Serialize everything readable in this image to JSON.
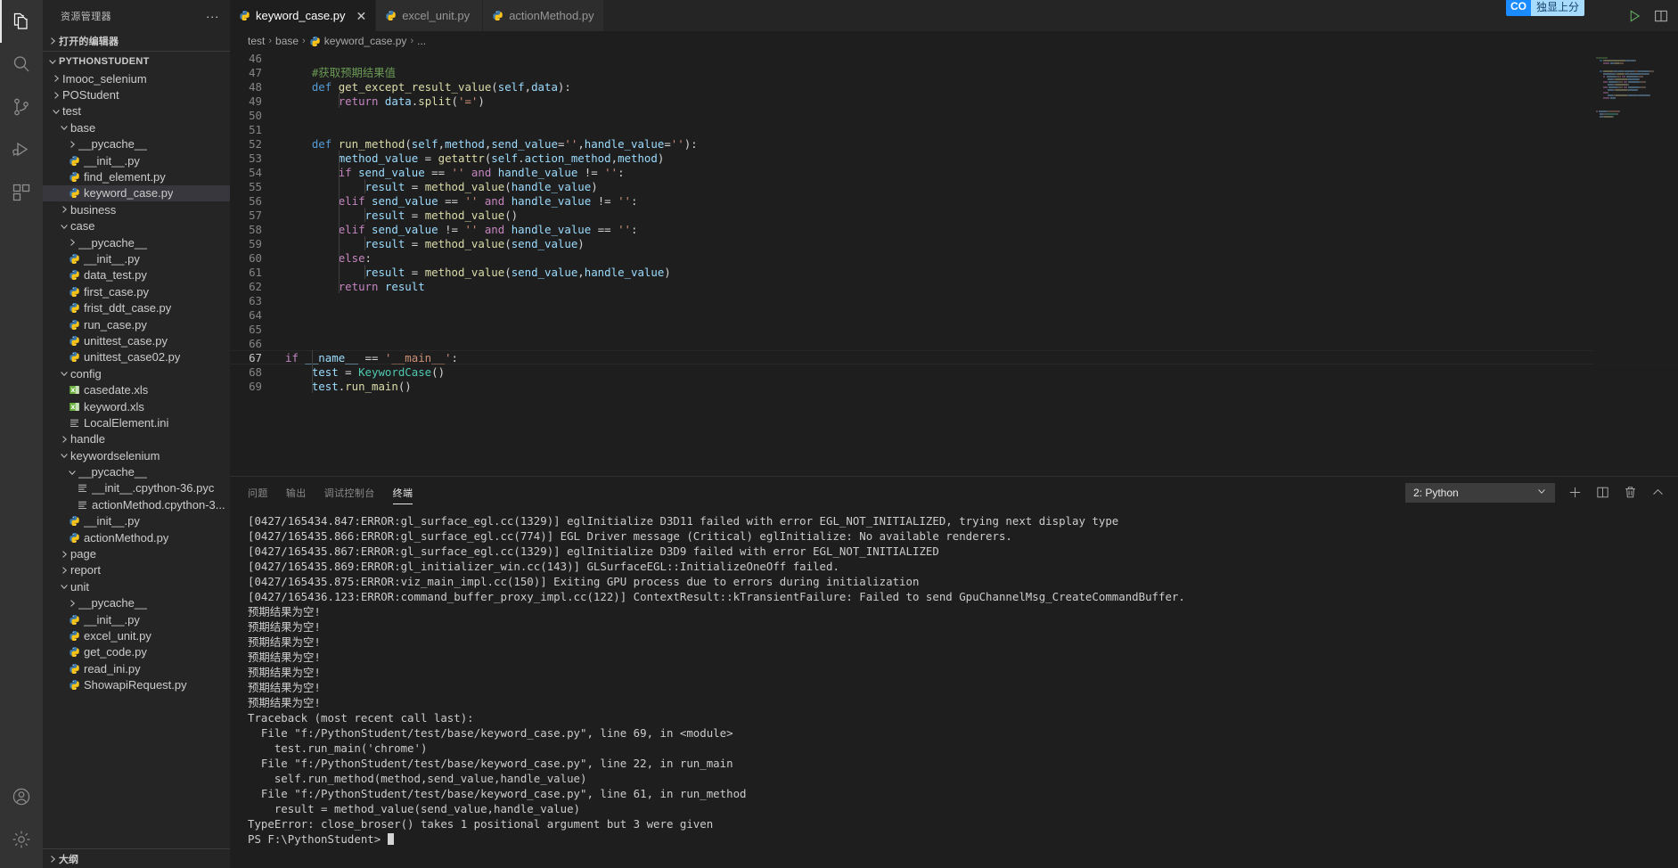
{
  "activitybar": {
    "items": [
      {
        "name": "explorer-icon",
        "label": "资源管理器",
        "active": true
      },
      {
        "name": "search-icon",
        "label": "搜索",
        "active": false
      },
      {
        "name": "source-control-icon",
        "label": "源代码管理",
        "active": false
      },
      {
        "name": "run-debug-icon",
        "label": "运行和调试",
        "active": false
      },
      {
        "name": "extensions-icon",
        "label": "扩展",
        "active": false
      }
    ],
    "bottom": [
      {
        "name": "account-icon",
        "label": "帐户"
      },
      {
        "name": "manage-gear-icon",
        "label": "管理"
      }
    ]
  },
  "sidebar": {
    "title": "资源管理器",
    "more_label": "···",
    "open_editors_label": "打开的编辑器",
    "root_label": "PYTHONSTUDENT",
    "outline_label": "大纲",
    "tree": [
      {
        "label": "Imooc_selenium",
        "depth": 1,
        "type": "folder",
        "state": "collapsed"
      },
      {
        "label": "POStudent",
        "depth": 1,
        "type": "folder",
        "state": "collapsed"
      },
      {
        "label": "test",
        "depth": 1,
        "type": "folder",
        "state": "expanded"
      },
      {
        "label": "base",
        "depth": 2,
        "type": "folder",
        "state": "expanded"
      },
      {
        "label": "__pycache__",
        "depth": 3,
        "type": "folder",
        "state": "collapsed"
      },
      {
        "label": "__init__.py",
        "depth": 3,
        "type": "python"
      },
      {
        "label": "find_element.py",
        "depth": 3,
        "type": "python"
      },
      {
        "label": "keyword_case.py",
        "depth": 3,
        "type": "python",
        "selected": true
      },
      {
        "label": "business",
        "depth": 2,
        "type": "folder",
        "state": "collapsed"
      },
      {
        "label": "case",
        "depth": 2,
        "type": "folder",
        "state": "expanded"
      },
      {
        "label": "__pycache__",
        "depth": 3,
        "type": "folder",
        "state": "collapsed"
      },
      {
        "label": "__init__.py",
        "depth": 3,
        "type": "python"
      },
      {
        "label": "data_test.py",
        "depth": 3,
        "type": "python"
      },
      {
        "label": "first_case.py",
        "depth": 3,
        "type": "python"
      },
      {
        "label": "frist_ddt_case.py",
        "depth": 3,
        "type": "python"
      },
      {
        "label": "run_case.py",
        "depth": 3,
        "type": "python"
      },
      {
        "label": "unittest_case.py",
        "depth": 3,
        "type": "python"
      },
      {
        "label": "unittest_case02.py",
        "depth": 3,
        "type": "python"
      },
      {
        "label": "config",
        "depth": 2,
        "type": "folder",
        "state": "expanded"
      },
      {
        "label": "casedate.xls",
        "depth": 3,
        "type": "excel"
      },
      {
        "label": "keyword.xls",
        "depth": 3,
        "type": "excel"
      },
      {
        "label": "LocalElement.ini",
        "depth": 3,
        "type": "ini"
      },
      {
        "label": "handle",
        "depth": 2,
        "type": "folder",
        "state": "collapsed"
      },
      {
        "label": "keywordselenium",
        "depth": 2,
        "type": "folder",
        "state": "expanded"
      },
      {
        "label": "__pycache__",
        "depth": 3,
        "type": "folder",
        "state": "expanded"
      },
      {
        "label": "__init__.cpython-36.pyc",
        "depth": 4,
        "type": "ini"
      },
      {
        "label": "actionMethod.cpython-3...",
        "depth": 4,
        "type": "ini"
      },
      {
        "label": "__init__.py",
        "depth": 3,
        "type": "python"
      },
      {
        "label": "actionMethod.py",
        "depth": 3,
        "type": "python"
      },
      {
        "label": "page",
        "depth": 2,
        "type": "folder",
        "state": "collapsed"
      },
      {
        "label": "report",
        "depth": 2,
        "type": "folder",
        "state": "collapsed"
      },
      {
        "label": "unit",
        "depth": 2,
        "type": "folder",
        "state": "expanded"
      },
      {
        "label": "__pycache__",
        "depth": 3,
        "type": "folder",
        "state": "collapsed"
      },
      {
        "label": "__init__.py",
        "depth": 3,
        "type": "python"
      },
      {
        "label": "excel_unit.py",
        "depth": 3,
        "type": "python"
      },
      {
        "label": "get_code.py",
        "depth": 3,
        "type": "python"
      },
      {
        "label": "read_ini.py",
        "depth": 3,
        "type": "python"
      },
      {
        "label": "ShowapiRequest.py",
        "depth": 3,
        "type": "python"
      }
    ]
  },
  "editor": {
    "tabs": [
      {
        "label": "keyword_case.py",
        "active": true,
        "close_glyph": "✕"
      },
      {
        "label": "excel_unit.py",
        "active": false
      },
      {
        "label": "actionMethod.py",
        "active": false
      }
    ],
    "breadcrumb": [
      "test",
      "base",
      "keyword_case.py",
      "..."
    ],
    "breadcrumb_sep": "›",
    "first_line_number": 46,
    "lines": [
      {
        "n": 46,
        "tokens": []
      },
      {
        "n": 47,
        "tokens": [
          {
            "c": "cmt",
            "t": "    #获取预期结果值"
          }
        ]
      },
      {
        "n": 48,
        "tokens": [
          {
            "c": "plain",
            "t": "    "
          },
          {
            "c": "def",
            "t": "def"
          },
          {
            "c": "plain",
            "t": " "
          },
          {
            "c": "fn",
            "t": "get_except_result_value"
          },
          {
            "c": "plain",
            "t": "("
          },
          {
            "c": "var",
            "t": "self"
          },
          {
            "c": "plain",
            "t": ","
          },
          {
            "c": "var",
            "t": "data"
          },
          {
            "c": "plain",
            "t": "):"
          }
        ]
      },
      {
        "n": 49,
        "tokens": [
          {
            "c": "plain",
            "t": "        "
          },
          {
            "c": "kw",
            "t": "return"
          },
          {
            "c": "plain",
            "t": " "
          },
          {
            "c": "var",
            "t": "data"
          },
          {
            "c": "plain",
            "t": "."
          },
          {
            "c": "fn",
            "t": "split"
          },
          {
            "c": "plain",
            "t": "("
          },
          {
            "c": "str",
            "t": "'='"
          },
          {
            "c": "plain",
            "t": ")"
          }
        ]
      },
      {
        "n": 50,
        "tokens": []
      },
      {
        "n": 51,
        "tokens": []
      },
      {
        "n": 52,
        "tokens": [
          {
            "c": "plain",
            "t": "    "
          },
          {
            "c": "def",
            "t": "def"
          },
          {
            "c": "plain",
            "t": " "
          },
          {
            "c": "fn",
            "t": "run_method"
          },
          {
            "c": "plain",
            "t": "("
          },
          {
            "c": "var",
            "t": "self"
          },
          {
            "c": "plain",
            "t": ","
          },
          {
            "c": "var",
            "t": "method"
          },
          {
            "c": "plain",
            "t": ","
          },
          {
            "c": "var",
            "t": "send_value"
          },
          {
            "c": "plain",
            "t": "="
          },
          {
            "c": "str",
            "t": "''"
          },
          {
            "c": "plain",
            "t": ","
          },
          {
            "c": "var",
            "t": "handle_value"
          },
          {
            "c": "plain",
            "t": "="
          },
          {
            "c": "str",
            "t": "''"
          },
          {
            "c": "plain",
            "t": "):"
          }
        ]
      },
      {
        "n": 53,
        "tokens": [
          {
            "c": "plain",
            "t": "        "
          },
          {
            "c": "var",
            "t": "method_value"
          },
          {
            "c": "plain",
            "t": " = "
          },
          {
            "c": "fn",
            "t": "getattr"
          },
          {
            "c": "plain",
            "t": "("
          },
          {
            "c": "var",
            "t": "self"
          },
          {
            "c": "plain",
            "t": "."
          },
          {
            "c": "var",
            "t": "action_method"
          },
          {
            "c": "plain",
            "t": ","
          },
          {
            "c": "var",
            "t": "method"
          },
          {
            "c": "plain",
            "t": ")"
          }
        ]
      },
      {
        "n": 54,
        "tokens": [
          {
            "c": "plain",
            "t": "        "
          },
          {
            "c": "kw",
            "t": "if"
          },
          {
            "c": "plain",
            "t": " "
          },
          {
            "c": "var",
            "t": "send_value"
          },
          {
            "c": "plain",
            "t": " == "
          },
          {
            "c": "str",
            "t": "''"
          },
          {
            "c": "plain",
            "t": " "
          },
          {
            "c": "kw",
            "t": "and"
          },
          {
            "c": "plain",
            "t": " "
          },
          {
            "c": "var",
            "t": "handle_value"
          },
          {
            "c": "plain",
            "t": " != "
          },
          {
            "c": "str",
            "t": "''"
          },
          {
            "c": "plain",
            "t": ":"
          }
        ]
      },
      {
        "n": 55,
        "tokens": [
          {
            "c": "plain",
            "t": "            "
          },
          {
            "c": "var",
            "t": "result"
          },
          {
            "c": "plain",
            "t": " = "
          },
          {
            "c": "fn",
            "t": "method_value"
          },
          {
            "c": "plain",
            "t": "("
          },
          {
            "c": "var",
            "t": "handle_value"
          },
          {
            "c": "plain",
            "t": ")"
          }
        ]
      },
      {
        "n": 56,
        "tokens": [
          {
            "c": "plain",
            "t": "        "
          },
          {
            "c": "kw",
            "t": "elif"
          },
          {
            "c": "plain",
            "t": " "
          },
          {
            "c": "var",
            "t": "send_value"
          },
          {
            "c": "plain",
            "t": " == "
          },
          {
            "c": "str",
            "t": "''"
          },
          {
            "c": "plain",
            "t": " "
          },
          {
            "c": "kw",
            "t": "and"
          },
          {
            "c": "plain",
            "t": " "
          },
          {
            "c": "var",
            "t": "handle_value"
          },
          {
            "c": "plain",
            "t": " != "
          },
          {
            "c": "str",
            "t": "''"
          },
          {
            "c": "plain",
            "t": ":"
          }
        ]
      },
      {
        "n": 57,
        "tokens": [
          {
            "c": "plain",
            "t": "            "
          },
          {
            "c": "var",
            "t": "result"
          },
          {
            "c": "plain",
            "t": " = "
          },
          {
            "c": "fn",
            "t": "method_value"
          },
          {
            "c": "plain",
            "t": "()"
          }
        ]
      },
      {
        "n": 58,
        "tokens": [
          {
            "c": "plain",
            "t": "        "
          },
          {
            "c": "kw",
            "t": "elif"
          },
          {
            "c": "plain",
            "t": " "
          },
          {
            "c": "var",
            "t": "send_value"
          },
          {
            "c": "plain",
            "t": " != "
          },
          {
            "c": "str",
            "t": "''"
          },
          {
            "c": "plain",
            "t": " "
          },
          {
            "c": "kw",
            "t": "and"
          },
          {
            "c": "plain",
            "t": " "
          },
          {
            "c": "var",
            "t": "handle_value"
          },
          {
            "c": "plain",
            "t": " == "
          },
          {
            "c": "str",
            "t": "''"
          },
          {
            "c": "plain",
            "t": ":"
          }
        ]
      },
      {
        "n": 59,
        "tokens": [
          {
            "c": "plain",
            "t": "            "
          },
          {
            "c": "var",
            "t": "result"
          },
          {
            "c": "plain",
            "t": " = "
          },
          {
            "c": "fn",
            "t": "method_value"
          },
          {
            "c": "plain",
            "t": "("
          },
          {
            "c": "var",
            "t": "send_value"
          },
          {
            "c": "plain",
            "t": ")"
          }
        ]
      },
      {
        "n": 60,
        "tokens": [
          {
            "c": "plain",
            "t": "        "
          },
          {
            "c": "kw",
            "t": "else"
          },
          {
            "c": "plain",
            "t": ":"
          }
        ]
      },
      {
        "n": 61,
        "tokens": [
          {
            "c": "plain",
            "t": "            "
          },
          {
            "c": "var",
            "t": "result"
          },
          {
            "c": "plain",
            "t": " = "
          },
          {
            "c": "fn",
            "t": "method_value"
          },
          {
            "c": "plain",
            "t": "("
          },
          {
            "c": "var",
            "t": "send_value"
          },
          {
            "c": "plain",
            "t": ","
          },
          {
            "c": "var",
            "t": "handle_value"
          },
          {
            "c": "plain",
            "t": ")"
          }
        ]
      },
      {
        "n": 62,
        "tokens": [
          {
            "c": "plain",
            "t": "        "
          },
          {
            "c": "kw",
            "t": "return"
          },
          {
            "c": "plain",
            "t": " "
          },
          {
            "c": "var",
            "t": "result"
          }
        ]
      },
      {
        "n": 63,
        "tokens": []
      },
      {
        "n": 64,
        "tokens": []
      },
      {
        "n": 65,
        "tokens": []
      },
      {
        "n": 66,
        "tokens": []
      },
      {
        "n": 67,
        "tokens": [
          {
            "c": "kw",
            "t": "if"
          },
          {
            "c": "plain",
            "t": " "
          },
          {
            "c": "var",
            "t": "__name__"
          },
          {
            "c": "plain",
            "t": " == "
          },
          {
            "c": "str",
            "t": "'__main__'"
          },
          {
            "c": "plain",
            "t": ":"
          }
        ],
        "current": true
      },
      {
        "n": 68,
        "tokens": [
          {
            "c": "plain",
            "t": "    "
          },
          {
            "c": "var",
            "t": "test"
          },
          {
            "c": "plain",
            "t": " = "
          },
          {
            "c": "cls",
            "t": "KeywordCase"
          },
          {
            "c": "plain",
            "t": "()"
          }
        ]
      },
      {
        "n": 69,
        "tokens": [
          {
            "c": "plain",
            "t": "    "
          },
          {
            "c": "var",
            "t": "test"
          },
          {
            "c": "plain",
            "t": "."
          },
          {
            "c": "fn",
            "t": "run_main"
          },
          {
            "c": "plain",
            "t": "()"
          }
        ]
      }
    ]
  },
  "topbadge": {
    "left": "CO",
    "right": "独显上分"
  },
  "panel": {
    "tabs": [
      {
        "label": "问题",
        "active": false
      },
      {
        "label": "输出",
        "active": false
      },
      {
        "label": "调试控制台",
        "active": false
      },
      {
        "label": "终端",
        "active": true
      }
    ],
    "terminal_select_value": "2: Python",
    "chevron": "⌄",
    "tools": [
      {
        "name": "new-terminal-icon",
        "label": "+"
      },
      {
        "name": "split-terminal-icon",
        "label": "split"
      },
      {
        "name": "kill-terminal-icon",
        "label": "trash"
      },
      {
        "name": "close-panel-icon",
        "label": "^"
      }
    ],
    "terminal_lines": [
      "[0427/165434.847:ERROR:gl_surface_egl.cc(1329)] eglInitialize D3D11 failed with error EGL_NOT_INITIALIZED, trying next display type",
      "[0427/165435.866:ERROR:gl_surface_egl.cc(774)] EGL Driver message (Critical) eglInitialize: No available renderers.",
      "[0427/165435.867:ERROR:gl_surface_egl.cc(1329)] eglInitialize D3D9 failed with error EGL_NOT_INITIALIZED",
      "[0427/165435.869:ERROR:gl_initializer_win.cc(143)] GLSurfaceEGL::InitializeOneOff failed.",
      "[0427/165435.875:ERROR:viz_main_impl.cc(150)] Exiting GPU process due to errors during initialization",
      "[0427/165436.123:ERROR:command_buffer_proxy_impl.cc(122)] ContextResult::kTransientFailure: Failed to send GpuChannelMsg_CreateCommandBuffer.",
      "预期结果为空!",
      "预期结果为空!",
      "预期结果为空!",
      "预期结果为空!",
      "预期结果为空!",
      "预期结果为空!",
      "预期结果为空!",
      "Traceback (most recent call last):",
      "  File \"f:/PythonStudent/test/base/keyword_case.py\", line 69, in <module>",
      "    test.run_main('chrome')",
      "  File \"f:/PythonStudent/test/base/keyword_case.py\", line 22, in run_main",
      "    self.run_method(method,send_value,handle_value)",
      "  File \"f:/PythonStudent/test/base/keyword_case.py\", line 61, in run_method",
      "    result = method_value(send_value,handle_value)",
      "TypeError: close_broser() takes 1 positional argument but 3 were given"
    ],
    "prompt": "PS F:\\PythonStudent> "
  }
}
